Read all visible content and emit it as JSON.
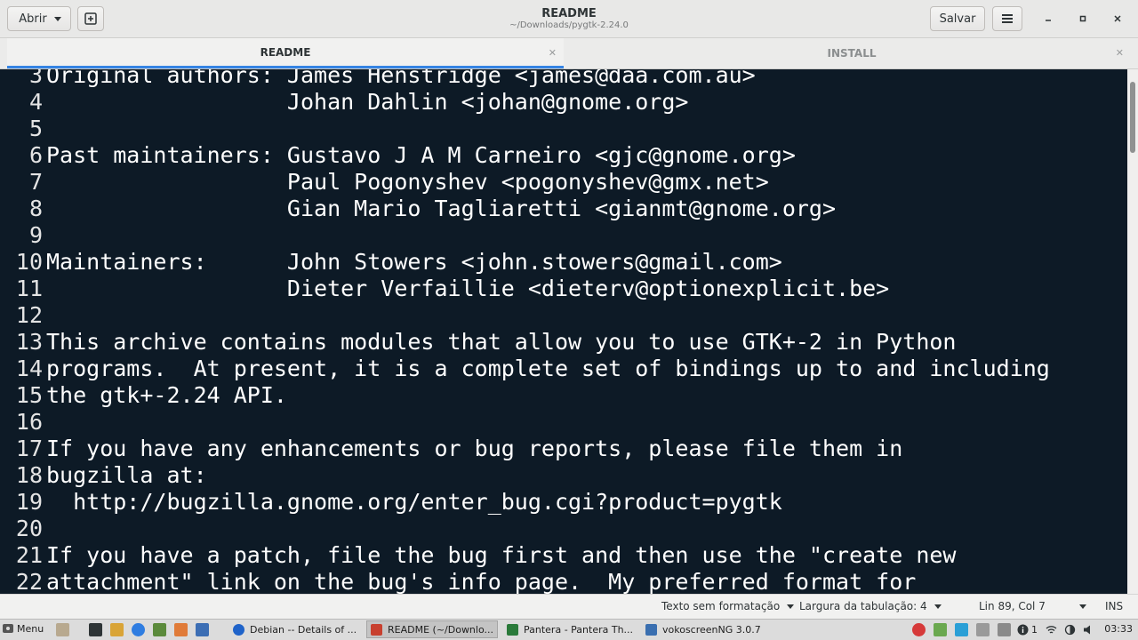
{
  "header": {
    "open_label": "Abrir",
    "title": "README",
    "subtitle": "~/Downloads/pygtk-2.24.0",
    "save_label": "Salvar"
  },
  "tabs": [
    {
      "label": "README",
      "active": true
    },
    {
      "label": "INSTALL",
      "active": false
    }
  ],
  "editor": {
    "lines": [
      {
        "n": "3",
        "text": "Original authors: James Henstridge <james@daa.com.au>"
      },
      {
        "n": "4",
        "text": "                  Johan Dahlin <johan@gnome.org>"
      },
      {
        "n": "5",
        "text": ""
      },
      {
        "n": "6",
        "text": "Past maintainers: Gustavo J A M Carneiro <gjc@gnome.org>"
      },
      {
        "n": "7",
        "text": "                  Paul Pogonyshev <pogonyshev@gmx.net>"
      },
      {
        "n": "8",
        "text": "                  Gian Mario Tagliaretti <gianmt@gnome.org>"
      },
      {
        "n": "9",
        "text": ""
      },
      {
        "n": "10",
        "text": "Maintainers:      John Stowers <john.stowers@gmail.com>"
      },
      {
        "n": "11",
        "text": "                  Dieter Verfaillie <dieterv@optionexplicit.be>"
      },
      {
        "n": "12",
        "text": ""
      },
      {
        "n": "13",
        "text": "This archive contains modules that allow you to use GTK+-2 in Python"
      },
      {
        "n": "14",
        "text": "programs.  At present, it is a complete set of bindings up to and including"
      },
      {
        "n": "15",
        "text": "the gtk+-2.24 API."
      },
      {
        "n": "16",
        "text": ""
      },
      {
        "n": "17",
        "text": "If you have any enhancements or bug reports, please file them in"
      },
      {
        "n": "18",
        "text": "bugzilla at:"
      },
      {
        "n": "19",
        "text": "  http://bugzilla.gnome.org/enter_bug.cgi?product=pygtk"
      },
      {
        "n": "20",
        "text": ""
      },
      {
        "n": "21",
        "text": "If you have a patch, file the bug first and then use the \"create new"
      },
      {
        "n": "22",
        "text": "attachment\" link on the bug's info page.  My preferred format for"
      }
    ]
  },
  "statusbar": {
    "format": "Texto sem formatação",
    "tab_width": "Largura da tabulação: 4",
    "position": "Lin 89, Col 7",
    "mode": "INS"
  },
  "taskbar": {
    "menu_label": "Menu",
    "tasks": [
      {
        "label": "Debian -- Details of ...",
        "color": "#1f63c9",
        "active": false
      },
      {
        "label": "README (~/Downlo...",
        "color": "#c8402f",
        "active": true
      },
      {
        "label": "Pantera - Pantera Th...",
        "color": "#2a7a3a",
        "active": false
      },
      {
        "label": "vokoscreenNG 3.0.7",
        "color": "#3a6fb0",
        "active": false
      }
    ],
    "tray_text": "1",
    "clock": "03:33"
  },
  "colors": {
    "editor_bg": "#0d1a26",
    "accent": "#3584e4"
  }
}
